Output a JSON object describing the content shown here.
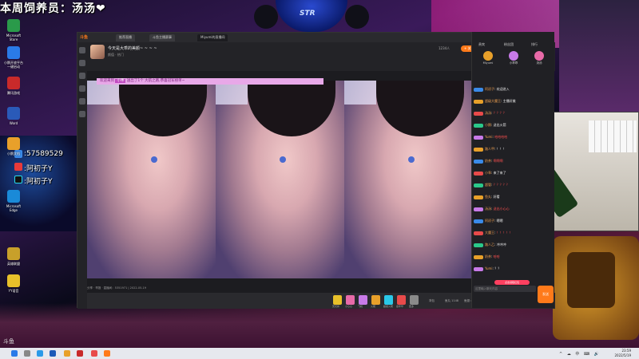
{
  "overlay": {
    "banner": "本周饲养员：汤汤❤",
    "lines": [
      {
        "icon": "qq-icon",
        "color": "#3a8ae8",
        "text": ":57589529"
      },
      {
        "icon": "weibo-icon",
        "color": "#e83a3a",
        "text": ":阿初子Y"
      },
      {
        "icon": "tiktok-icon",
        "color": "#111111",
        "text": ":阿初子Y"
      }
    ],
    "camera_brand": "STR"
  },
  "desktop_icons": [
    {
      "label": "Microsoft\nStore",
      "color": "#2a9a4a"
    },
    {
      "label": "小鹅开放平台\n一键启动",
      "color": "#2a7ae8"
    },
    {
      "label": "腾讯游戏",
      "color": "#c82a2a"
    },
    {
      "label": "Word",
      "color": "#2a5ab8"
    },
    {
      "label": "小鹅文档",
      "color": "#e8a02a"
    },
    {
      "label": "Microsoft\nEdge",
      "color": "#1a8ad8"
    },
    {
      "label": "英雄联盟",
      "color": "#c8a02a"
    },
    {
      "label": "YY语音",
      "color": "#e8c02a"
    }
  ],
  "app": {
    "logo": "斗鱼",
    "tabs": [
      "推荐直播",
      "斗鱼主播赛事",
      "Miyumi的直播间"
    ],
    "window_controls": "— ☐ ✕",
    "room_title": "今天是大乖的美颜~ ~ ~ ~",
    "room_sub": "颜值 · 热门",
    "viewers": "1234人",
    "follow_label": "+ 关注",
    "danmu_prefix": "欢迎来到",
    "danmu_text": "小乖",
    "danmu_rest": "送出了1个 大航之路,恭喜冠军榜单~",
    "video_footer": "分享 · 举报 · 直播间：5351971 | 2022-05-19",
    "gifts": [
      {
        "color": "#e8c02a",
        "label": "荧光棒"
      },
      {
        "color": "#e86aa8",
        "label": "小心心"
      },
      {
        "color": "#c87ae8",
        "label": "飞机"
      },
      {
        "color": "#e8a02a",
        "label": "火箭"
      },
      {
        "color": "#2ac8e8",
        "label": "超级火箭"
      },
      {
        "color": "#e84a4a",
        "label": "嘉年华"
      },
      {
        "color": "#8a8a8a",
        "label": "更多"
      }
    ],
    "gift_right": [
      "背包",
      "鱼丸 1148",
      "鱼翅 4"
    ]
  },
  "chat": {
    "tabs": [
      "贵宾",
      "粉丝团",
      "排行"
    ],
    "ranks": [
      {
        "name": "Miyumi",
        "color": "#e8a02a"
      },
      {
        "name": "小乖乖",
        "color": "#c87ae8"
      },
      {
        "name": "汤汤",
        "color": "#e86aa8"
      }
    ],
    "lines": [
      {
        "lv": "#3a8ae8",
        "name": "阿初子",
        "text": "欢迎进入",
        "red": false
      },
      {
        "lv": "#e8a02a",
        "name": "超级大魔王",
        "text": "主播好美",
        "red": false
      },
      {
        "lv": "#e84a4a",
        "name": "汤汤",
        "text": "？？？？",
        "red": true
      },
      {
        "lv": "#2ac88a",
        "name": "小鹅",
        "text": "送出火箭",
        "red": false
      },
      {
        "lv": "#c87ae8",
        "name": "Yumi",
        "text": "哈哈哈哈",
        "red": true
      },
      {
        "lv": "#e8a02a",
        "name": "路人甲",
        "text": "！！！",
        "red": false
      },
      {
        "lv": "#3a8ae8",
        "name": "奶茶",
        "text": "啊啊啊",
        "red": true
      },
      {
        "lv": "#e84a4a",
        "name": "小乖",
        "text": "来了来了",
        "red": false
      },
      {
        "lv": "#2ac88a",
        "name": "超管",
        "text": "？？？？？",
        "red": true
      },
      {
        "lv": "#e8a02a",
        "name": "鱼丸",
        "text": "好看",
        "red": false
      },
      {
        "lv": "#c87ae8",
        "name": "汤汤",
        "text": "送出小心心",
        "red": true
      },
      {
        "lv": "#3a8ae8",
        "name": "阿初子",
        "text": "嗯嗯",
        "red": false
      },
      {
        "lv": "#e84a4a",
        "name": "大魔王",
        "text": "！！！！！",
        "red": true
      },
      {
        "lv": "#2ac88a",
        "name": "路人乙",
        "text": "冲冲冲",
        "red": false
      },
      {
        "lv": "#e8a02a",
        "name": "奶茶",
        "text": "哈哈",
        "red": true
      },
      {
        "lv": "#c87ae8",
        "name": "Yumi",
        "text": "？？",
        "red": false
      }
    ],
    "input_placeholder": "这里输入聊天内容",
    "send_label": "发送",
    "red_button": "点击领取红包"
  },
  "taskbar": {
    "time": "23:59",
    "date": "2022/5/19",
    "tray": "^ ☁ 中 ⌨ 🔊",
    "icons": [
      "#2a7ae8",
      "#888888",
      "#2a9ae8",
      "#1a5ab8",
      "#e8a02a",
      "#c82a2a",
      "#e84a4a",
      "#ff7a1a"
    ]
  },
  "corner_logo": "斗鱼"
}
